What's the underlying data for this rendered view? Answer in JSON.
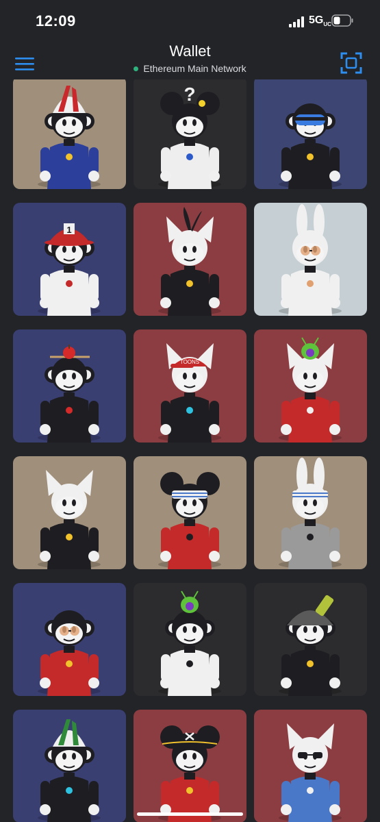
{
  "status_bar": {
    "time": "12:09",
    "network": "5G",
    "network_suffix": "UC"
  },
  "header": {
    "title": "Wallet",
    "network_label": "Ethereum Main Network",
    "accent": "#2d8ef0",
    "network_dot_color": "#2fb37e"
  },
  "nft_grid": {
    "items": [
      {
        "bg": "#a08f7b",
        "head": "monkey",
        "hat": "striped-hat",
        "hat_color": "#c9282c",
        "outfit": "#2c3f9a",
        "accent": "#f2c22d"
      },
      {
        "bg": "#2c2c2e",
        "head": "mouse",
        "hat": "question",
        "hat_color": "#f2d12d",
        "outfit": "#eeeeee",
        "accent": "#2c5ac9"
      },
      {
        "bg": "#3d4572",
        "head": "monkey",
        "hat": "goggles",
        "hat_color": "#3a7be0",
        "outfit": "#1e1e22",
        "accent": "#f2c22d"
      },
      {
        "bg": "#3a3f72",
        "head": "monkey",
        "hat": "fire-helmet",
        "hat_color": "#c42a2a",
        "outfit": "#f0f0f0",
        "accent": "#c42a2a"
      },
      {
        "bg": "#8c3d42",
        "head": "cat",
        "hat": "tuft",
        "hat_color": "#1e1e22",
        "outfit": "#1e1e22",
        "accent": "#f2c22d"
      },
      {
        "bg": "#c6d0d4",
        "head": "bunny",
        "hat": "glasses",
        "hat_color": "#e0a070",
        "outfit": "#f0f0f0",
        "accent": "#e0a070"
      },
      {
        "bg": "#3a3f72",
        "head": "monkey",
        "hat": "apple",
        "hat_color": "#d42a2a",
        "outfit": "#1e1e22",
        "accent": "#d42a2a"
      },
      {
        "bg": "#8c3d42",
        "head": "cat",
        "hat": "cap",
        "hat_color": "#c42a2a",
        "outfit": "#1e1e22",
        "accent": "#2fc2e0"
      },
      {
        "bg": "#8c3d42",
        "head": "cat",
        "hat": "alien",
        "hat_color": "#5ec23a",
        "outfit": "#c42a2a",
        "accent": "#f0f0f0"
      },
      {
        "bg": "#a08f7b",
        "head": "cat",
        "hat": "none",
        "hat_color": "#f0f0f0",
        "outfit": "#1e1e22",
        "accent": "#f2c22d"
      },
      {
        "bg": "#a08f7b",
        "head": "mouse",
        "hat": "headband",
        "hat_color": "#4a78c8",
        "outfit": "#c42a2a",
        "accent": "#1e1e22"
      },
      {
        "bg": "#a08f7b",
        "head": "bunny",
        "hat": "headband",
        "hat_color": "#4a78c8",
        "outfit": "#9a9a9a",
        "accent": "#1e1e22"
      },
      {
        "bg": "#3a3f72",
        "head": "monkey",
        "hat": "glasses",
        "hat_color": "#e0a070",
        "outfit": "#c42a2a",
        "accent": "#f2c22d"
      },
      {
        "bg": "#2c2c2e",
        "head": "monkey",
        "hat": "alien",
        "hat_color": "#5ec23a",
        "outfit": "#f0f0f0",
        "accent": "#1e1e22"
      },
      {
        "bg": "#2c2c2e",
        "head": "monkey",
        "hat": "army-helmet",
        "hat_color": "#5a5a5a",
        "outfit": "#1e1e22",
        "accent": "#f2c22d"
      },
      {
        "bg": "#3a3f72",
        "head": "monkey",
        "hat": "striped-hat",
        "hat_color": "#2f8a3a",
        "outfit": "#1e1e22",
        "accent": "#2fc2e0"
      },
      {
        "bg": "#8c3d42",
        "head": "mouse",
        "hat": "pirate",
        "hat_color": "#1e1e22",
        "outfit": "#c42a2a",
        "accent": "#f2c22d"
      },
      {
        "bg": "#8c3d42",
        "head": "cat",
        "hat": "sunglasses",
        "hat_color": "#1e1e22",
        "outfit": "#4a78c8",
        "accent": "#f0f0f0"
      }
    ]
  }
}
